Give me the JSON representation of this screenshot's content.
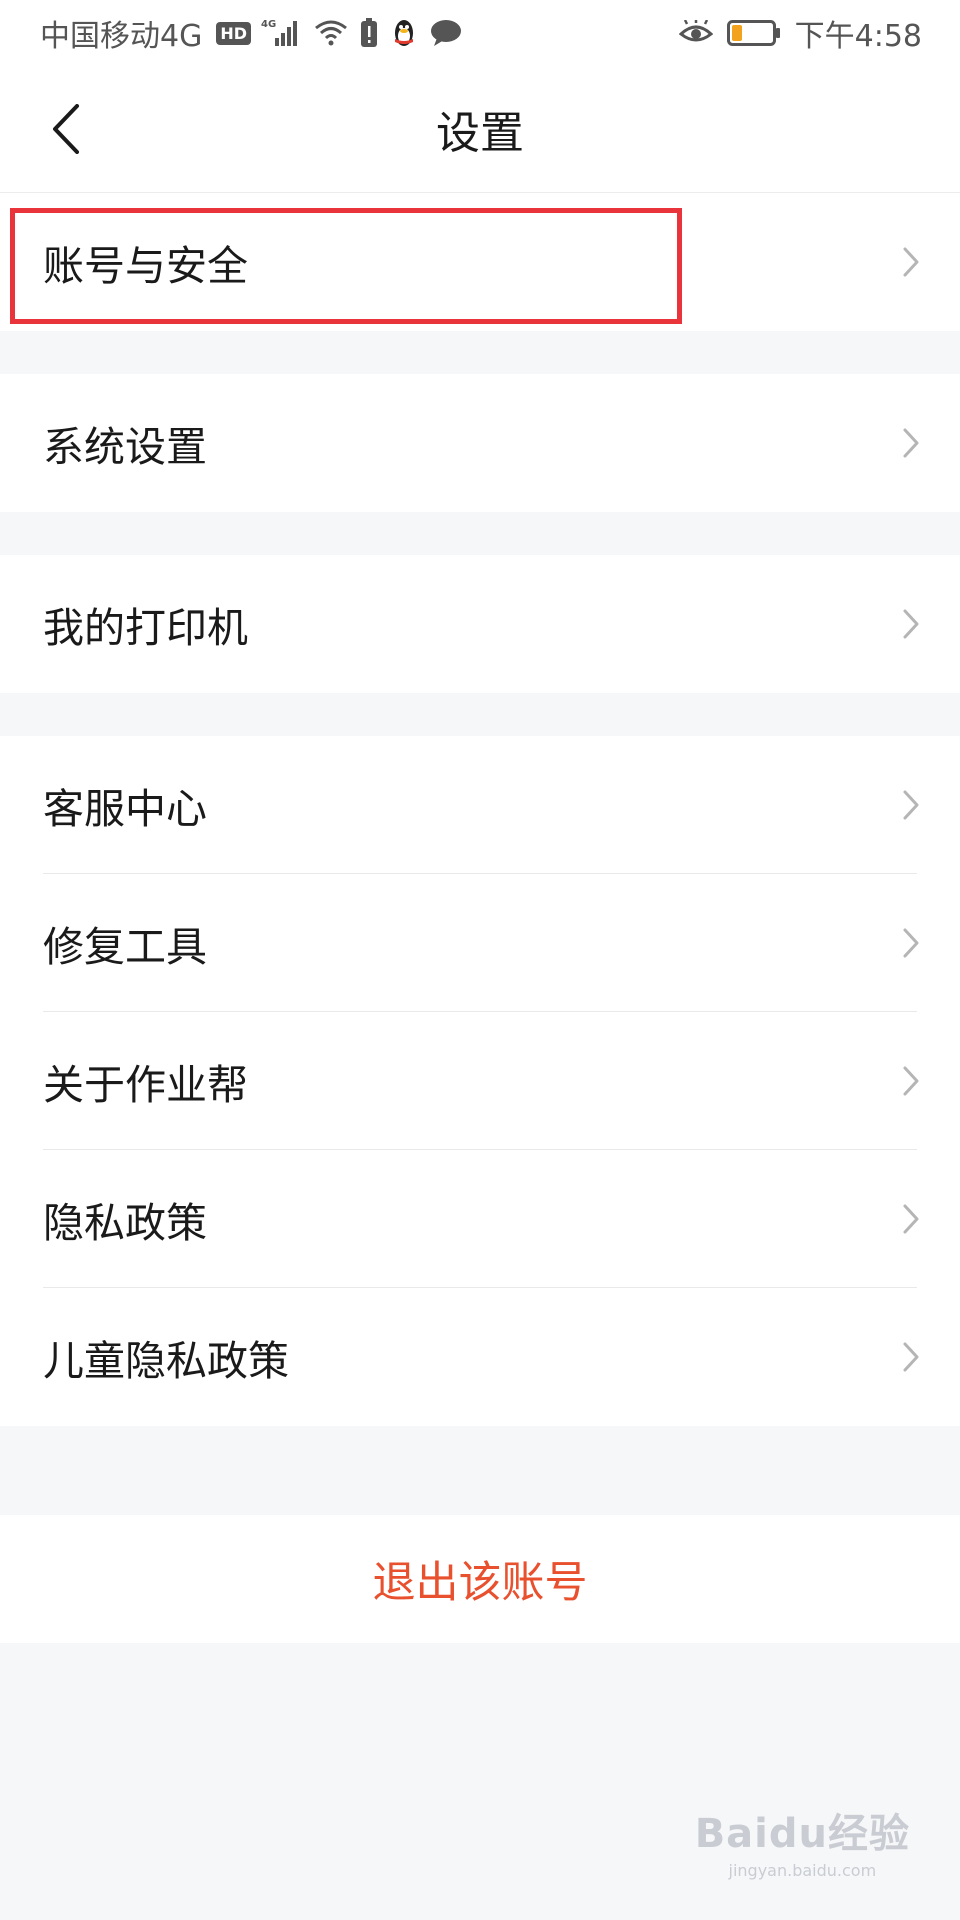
{
  "status_bar": {
    "carrier": "中国移动4G",
    "hd_badge": "HD",
    "time": "下午4:58"
  },
  "nav": {
    "title": "设置"
  },
  "groups": [
    {
      "items": [
        {
          "label": "账号与安全"
        }
      ]
    },
    {
      "items": [
        {
          "label": "系统设置"
        }
      ]
    },
    {
      "items": [
        {
          "label": "我的打印机"
        }
      ]
    },
    {
      "items": [
        {
          "label": "客服中心"
        },
        {
          "label": "修复工具"
        },
        {
          "label": "关于作业帮"
        },
        {
          "label": "隐私政策"
        },
        {
          "label": "儿童隐私政策"
        }
      ]
    }
  ],
  "logout": {
    "label": "退出该账号"
  },
  "watermark": {
    "main": "Baidu经验",
    "sub": "jingyan.baidu.com"
  },
  "colors": {
    "highlight_border": "#e8343a",
    "logout_text": "#e8502e",
    "page_background": "#f6f7f9"
  }
}
